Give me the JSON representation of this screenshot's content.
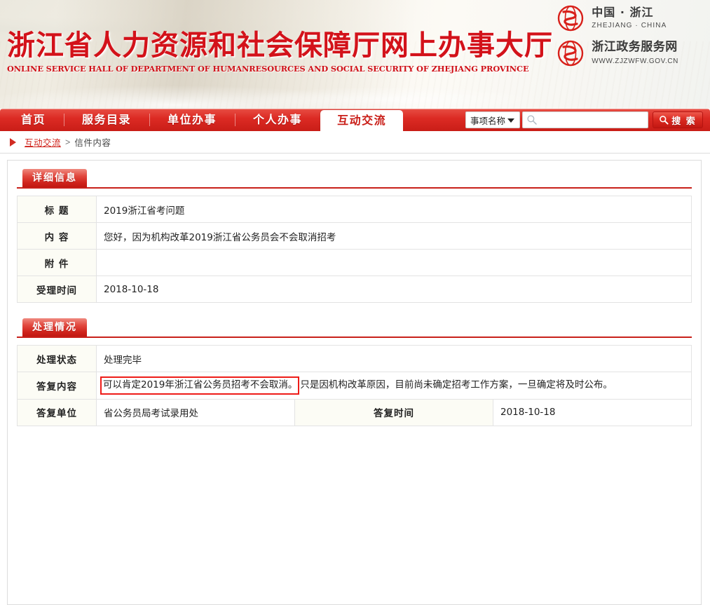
{
  "header": {
    "site_title": "浙江省人力资源和社会保障厅网上办事大厅",
    "site_subtitle": "ONLINE SERVICE HALL OF DEPARTMENT OF HUMANRESOURCES AND SOCIAL SECURITY OF ZHEJIANG PROVINCE",
    "logos": [
      {
        "cn": "中国 · 浙江",
        "en": "ZHEJIANG · CHINA",
        "icon": "zhejiang-emblem-icon"
      },
      {
        "cn": "浙江政务服务网",
        "en": "WWW.ZJZWFW.GOV.CN",
        "icon": "zhejiang-emblem-icon"
      }
    ],
    "brand_color": "#d3121a"
  },
  "nav": {
    "items": [
      {
        "label": "首页",
        "active": false
      },
      {
        "label": "服务目录",
        "active": false
      },
      {
        "label": "单位办事",
        "active": false
      },
      {
        "label": "个人办事",
        "active": false
      },
      {
        "label": "互动交流",
        "active": true
      }
    ],
    "bar_color": "#d52a22"
  },
  "search": {
    "category_selected": "事项名称",
    "category_options": [
      "事项名称"
    ],
    "input_value": "",
    "input_placeholder": "",
    "input_icon": "magnifier-icon",
    "button_label": "搜 索",
    "button_icon": "search-icon"
  },
  "breadcrumb": {
    "arrow_icon": "triangle-right-icon",
    "parent": "互动交流",
    "separator": ">",
    "current": "信件内容"
  },
  "sections": [
    {
      "tab_label": "详细信息",
      "rows": [
        {
          "label": "标  题",
          "value": "2019浙江省考问题"
        },
        {
          "label": "内  容",
          "value": "您好，因为机构改革2019浙江省公务员会不会取消招考"
        },
        {
          "label": "附  件",
          "value": ""
        },
        {
          "label": "受理时间",
          "value": "2018-10-18"
        }
      ]
    },
    {
      "tab_label": "处理情况",
      "rows": [
        {
          "label": "处理状态",
          "value": "处理完毕"
        },
        {
          "label": "答复内容",
          "value_highlighted": "可以肯定2019年浙江省公务员招考不会取消。",
          "value_rest": "只是因机构改革原因，目前尚未确定招考工作方案，一旦确定将及时公布。",
          "highlight_color": "#ee1c18"
        },
        {
          "label": "答复单位",
          "value": "省公务员局考试录用处",
          "label2": "答复时间",
          "value2": "2018-10-18"
        }
      ]
    }
  ]
}
